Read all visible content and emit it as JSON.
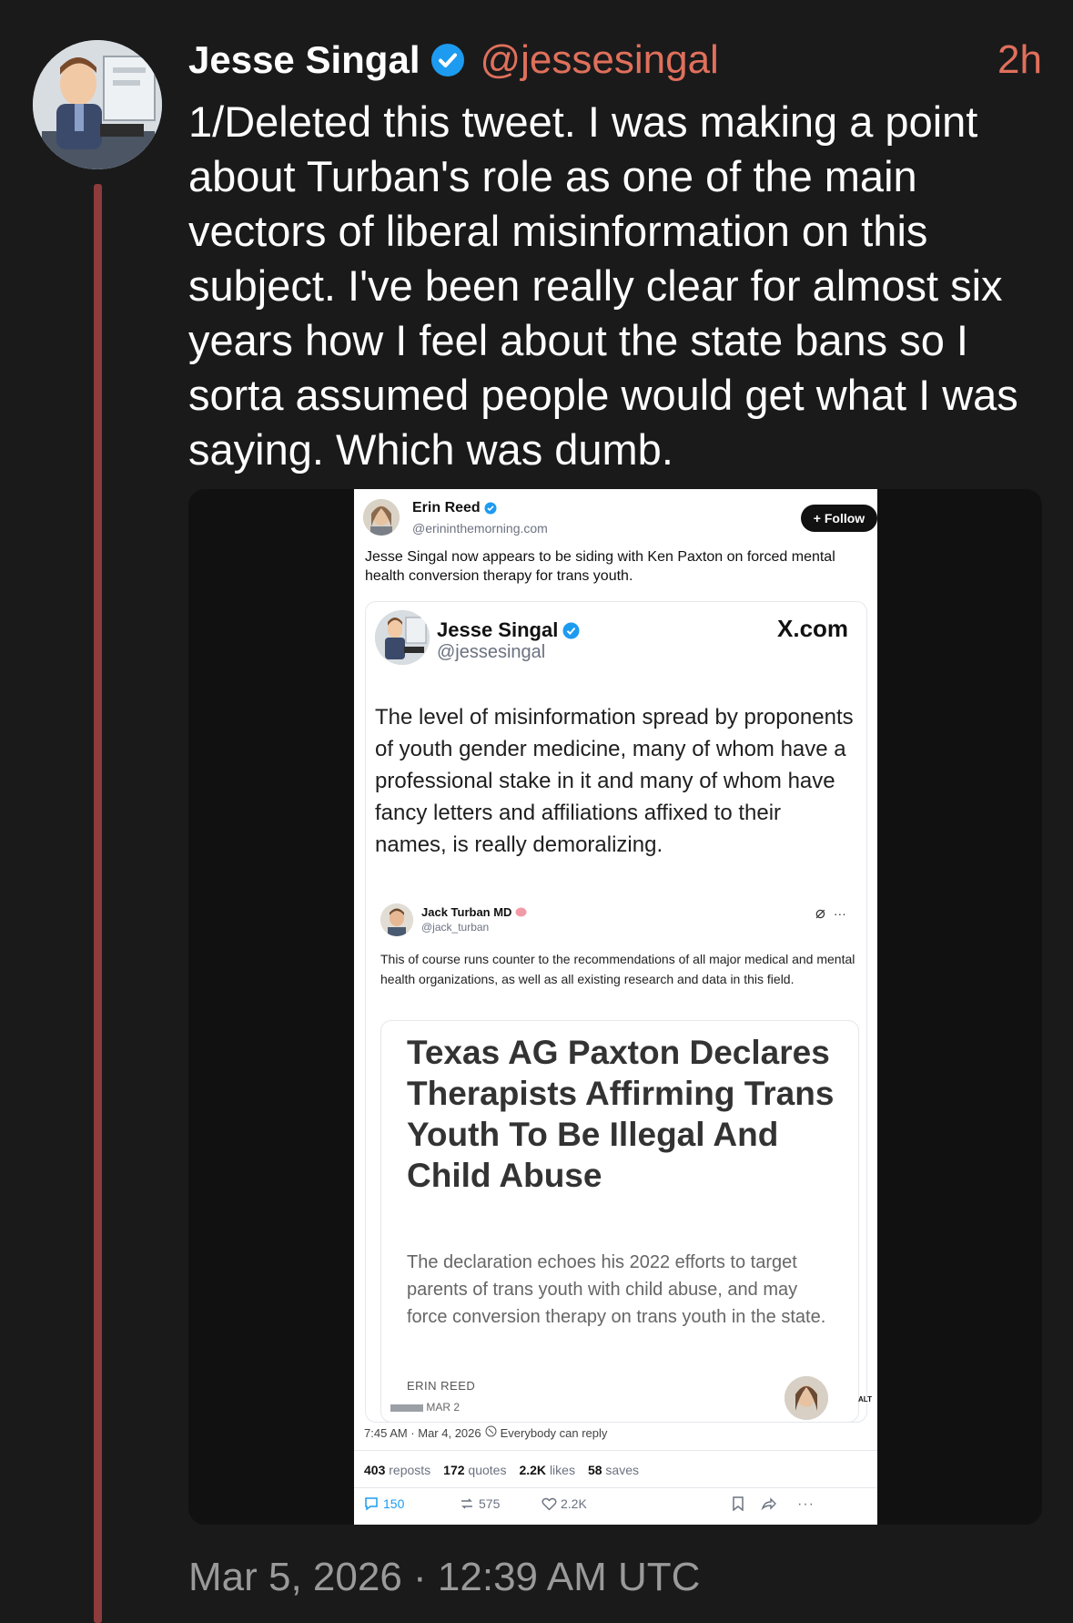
{
  "post": {
    "author_name": "Jesse Singal",
    "handle": "@jessesingal",
    "time_ago": "2h",
    "text": "1/Deleted this tweet. I was making a point about Turban's role as one of the main vectors of liberal misinformation on this subject. I've been really clear for almost six years how I feel about the state bans so I sorta assumed people would get what I was saying. Which was dumb.",
    "timestamp": "Mar 5, 2026 · 12:39 AM UTC",
    "accent_color": "#e0705b",
    "verified_color": "#1d9bf0"
  },
  "screenshot": {
    "outer": {
      "name": "Erin Reed",
      "handle": "@erininthemorning.com",
      "follow_label": "+ Follow",
      "text": "Jesse Singal now appears to be siding with Ken Paxton on forced mental health conversion therapy for trans youth.",
      "meta": {
        "time": "7:45 AM · Mar 4, 2026",
        "reply_setting": "Everybody can reply"
      },
      "stats": {
        "reposts": "403",
        "reposts_label": "reposts",
        "quotes": "172",
        "quotes_label": "quotes",
        "likes": "2.2K",
        "likes_label": "likes",
        "saves": "58",
        "saves_label": "saves"
      },
      "actions": {
        "replies": "150",
        "reposts": "575",
        "likes": "2.2K"
      }
    },
    "quoted": {
      "name": "Jesse Singal",
      "handle": "@jessesingal",
      "source": "X.com",
      "text": "The level of misinformation spread by proponents of youth gender medicine, many of whom have a professional stake in it and many of whom have fancy letters and affiliations affixed to their names, is really demoralizing."
    },
    "inner_quoted": {
      "name": "Jack Turban MD",
      "handle": "@jack_turban",
      "text": "This of course runs counter to the recommendations of all major medical and mental health organizations, as well as all existing research and data in this field.",
      "more": "···"
    },
    "article": {
      "title": "Texas AG Paxton Declares Therapists Affirming Trans Youth To Be Illegal And Child Abuse",
      "description": "The declaration echoes his 2022 efforts to target parents of trans youth with child abuse, and may force conversion therapy on trans youth in the state.",
      "author": "ERIN REED",
      "date": "MAR 2",
      "alt_badge": "ALT"
    }
  }
}
